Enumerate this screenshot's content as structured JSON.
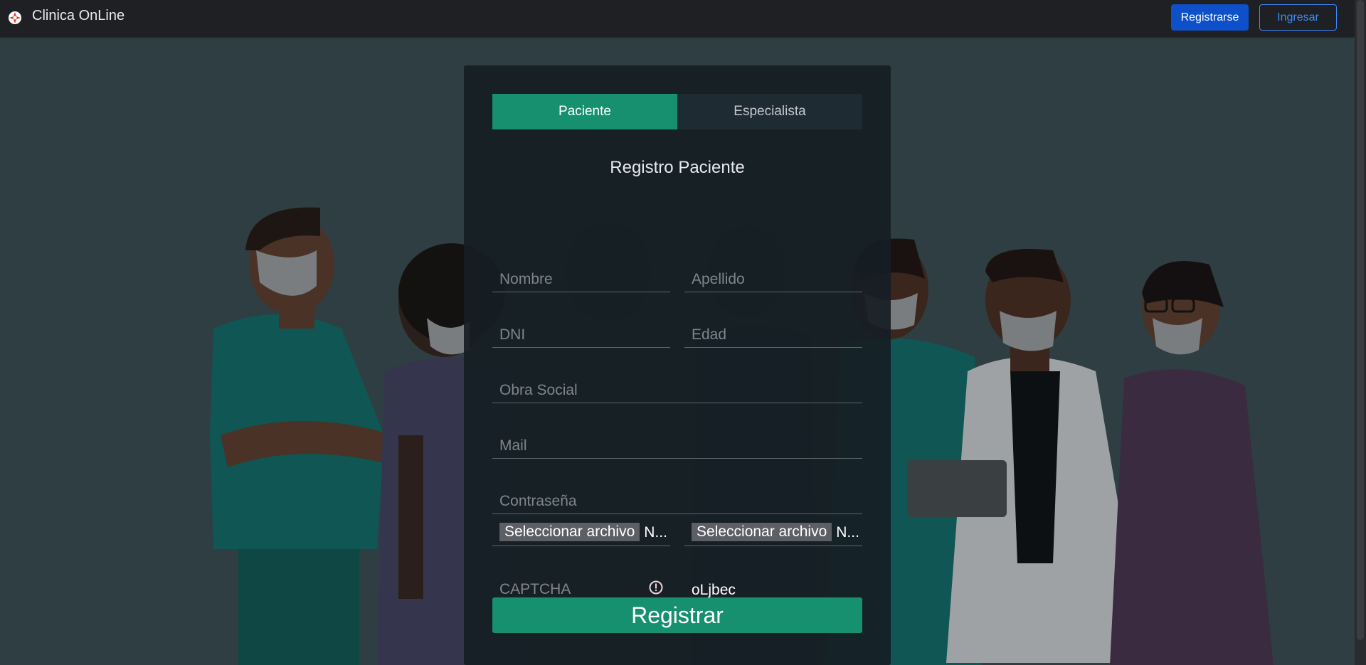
{
  "navbar": {
    "brand": "Clinica OnLine",
    "register_label": "Registrarse",
    "login_label": "Ingresar"
  },
  "form": {
    "tabs": [
      {
        "label": "Paciente",
        "active": true
      },
      {
        "label": "Especialista",
        "active": false
      }
    ],
    "title": "Registro Paciente",
    "fields": {
      "nombre": {
        "placeholder": "Nombre",
        "value": ""
      },
      "apellido": {
        "placeholder": "Apellido",
        "value": ""
      },
      "dni": {
        "placeholder": "DNI",
        "value": ""
      },
      "edad": {
        "placeholder": "Edad",
        "value": ""
      },
      "obra_social": {
        "placeholder": "Obra Social",
        "value": ""
      },
      "mail": {
        "placeholder": "Mail",
        "value": ""
      },
      "password": {
        "placeholder": "Contraseña",
        "value": ""
      }
    },
    "file_inputs": [
      {
        "button_label": "Seleccionar archivo",
        "status": "N..."
      },
      {
        "button_label": "Seleccionar archivo",
        "status": "N..."
      }
    ],
    "captcha": {
      "placeholder": "CAPTCHA",
      "code": "oLjbec",
      "has_error": true
    },
    "submit_label": "Registrar"
  },
  "colors": {
    "accent": "#16906e",
    "primary_button": "#0d50c9",
    "outline_button": "#3d8bfd",
    "error": "#c0394d"
  }
}
